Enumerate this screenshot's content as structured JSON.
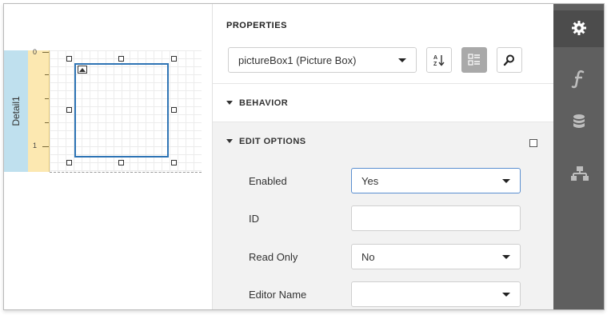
{
  "design": {
    "band_name": "Detail1",
    "ruler_marks": [
      "0",
      "1"
    ]
  },
  "properties": {
    "title": "PROPERTIES",
    "selected_component": "pictureBox1 (Picture Box)",
    "sort_alpha_icon": "sort-alphabetical-icon",
    "categories_icon": "categories-view-icon",
    "search_icon": "search-icon"
  },
  "sections": {
    "behavior": "BEHAVIOR",
    "edit_options": "EDIT OPTIONS"
  },
  "edit_options": {
    "enabled_label": "Enabled",
    "enabled_value": "Yes",
    "id_label": "ID",
    "id_value": "",
    "read_only_label": "Read Only",
    "read_only_value": "No",
    "editor_name_label": "Editor Name",
    "editor_name_value": ""
  },
  "rail": {
    "items": [
      "gear-icon",
      "function-icon",
      "database-icon",
      "hierarchy-icon"
    ],
    "active": "gear-icon"
  },
  "colors": {
    "selection_border": "#2e74b5",
    "band_label_bg": "#bfe0ee",
    "ruler_bg": "#fce8b1",
    "rail_bg": "#5f5f5f"
  }
}
